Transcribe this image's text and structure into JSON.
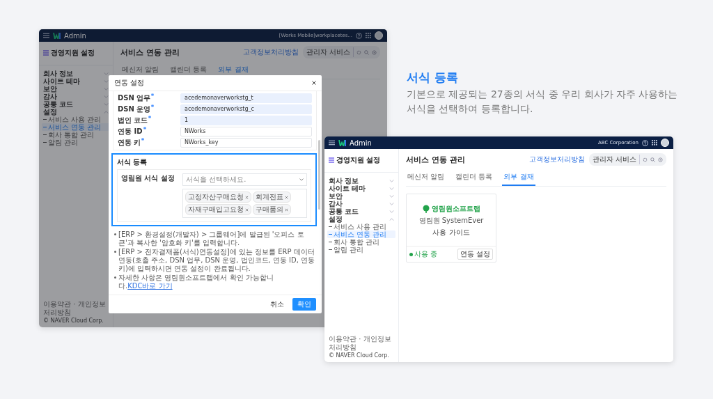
{
  "feature": {
    "title": "서식 등록",
    "description": "기본으로 제공되는 27종의 서식 중 우리 회사가 자주 사용하는 서식을 선택하여 등록합니다."
  },
  "back_window": {
    "header": {
      "app_name": "Admin",
      "organization": "[Works Mobile]workplacetes..."
    },
    "sidebar": {
      "title": "경영지원 설정",
      "items": [
        {
          "label": "회사 정보",
          "expanded": false
        },
        {
          "label": "사이트 테마",
          "expanded": false
        },
        {
          "label": "보안",
          "expanded": false
        },
        {
          "label": "감사",
          "expanded": false
        },
        {
          "label": "공통 코드",
          "expanded": false
        },
        {
          "label": "설정",
          "expanded": true,
          "children": [
            {
              "label": "서비스 사용 관리",
              "selected": false
            },
            {
              "label": "서비스 연동 관리",
              "selected": true
            },
            {
              "label": "회사 통합 관리",
              "selected": false
            },
            {
              "label": "알림 관리",
              "selected": false
            }
          ]
        }
      ],
      "footer": "이용약관 · 개인정보처리방침",
      "copyright": "© NAVER Cloud Corp."
    },
    "page": {
      "title": "서비스 연동 관리",
      "privacy_link": "고객정보처리방침",
      "service_button": "관리자 서비스",
      "tabs": [
        {
          "label": "메신저 알림",
          "selected": false
        },
        {
          "label": "캘린더 등록",
          "selected": false
        },
        {
          "label": "외부 결재",
          "selected": true
        }
      ]
    },
    "dialog": {
      "title": "연동 설정",
      "fields": [
        {
          "label": "DSN 업무",
          "required": true,
          "value": "acedemonaverworkstg_t",
          "readonly": true
        },
        {
          "label": "DSN 운영",
          "required": true,
          "value": "acedemonaverworkstg_c",
          "readonly": true
        },
        {
          "label": "법인 코드",
          "required": true,
          "value": "1",
          "readonly": true
        },
        {
          "label": "연동 ID",
          "required": true,
          "value": "NWorks",
          "readonly": false
        },
        {
          "label": "연동 키",
          "required": true,
          "value": "NWorks_key",
          "readonly": false
        }
      ],
      "section": {
        "title": "서식 등록",
        "label": "영림원 서식 설정",
        "placeholder": "서식을 선택하세요.",
        "tags": [
          "고정자산구매요청",
          "회계전표",
          "자재구매입고요청",
          "구매품의"
        ]
      },
      "notes": [
        {
          "text": "[ERP > 환경설정(개발자) > 그룹웨어]에 발급된 '오피스 토큰'과 복사한 '암호화 키'를 입력합니다."
        },
        {
          "text": "[ERP > 전자결재폼(서식)연동설정]에 있는 정보를 ERP 데이터 연동(호출 주소, DSN 업무, DSN 운영, 법인코드, 연동 ID, 연동 키)에 입력하시면 연동 설정이 완료됩니다."
        },
        {
          "text": "자세한 사항은 영림원소프트랩에서 확인 가능합니다.",
          "link": "KDC바로 가기"
        }
      ],
      "buttons": [
        {
          "label": "취소",
          "kind": "secondary"
        },
        {
          "label": "확인",
          "kind": "primary"
        }
      ]
    }
  },
  "front_window": {
    "header": {
      "app_name": "Admin",
      "organization": "ABC Corporation"
    },
    "sidebar": {
      "title": "경영지원 설정",
      "items": [
        {
          "label": "회사 정보",
          "expanded": false
        },
        {
          "label": "사이트 테마",
          "expanded": false
        },
        {
          "label": "보안",
          "expanded": false
        },
        {
          "label": "감사",
          "expanded": false
        },
        {
          "label": "공통 코드",
          "expanded": false
        },
        {
          "label": "설정",
          "expanded": true,
          "children": [
            {
              "label": "서비스 사용 관리",
              "selected": false
            },
            {
              "label": "서비스 연동 관리",
              "selected": true
            },
            {
              "label": "회사 통합 관리",
              "selected": false
            },
            {
              "label": "알림 관리",
              "selected": false
            }
          ]
        }
      ],
      "footer": "이용약관 · 개인정보처리방침",
      "copyright": "© NAVER Cloud Corp."
    },
    "page": {
      "title": "서비스 연동 관리",
      "privacy_link": "고객정보처리방침",
      "service_button": "관리자 서비스",
      "tabs": [
        {
          "label": "메신저 알림",
          "selected": false
        },
        {
          "label": "캘린더 등록",
          "selected": false
        },
        {
          "label": "외부 결재",
          "selected": true
        }
      ]
    },
    "card": {
      "brand": "영림원소프트랩",
      "product": "영림원 SystemEver",
      "guide": "사용 가이드",
      "status": {
        "label": "사용 중",
        "active": true
      },
      "button": "연동 설정"
    }
  }
}
